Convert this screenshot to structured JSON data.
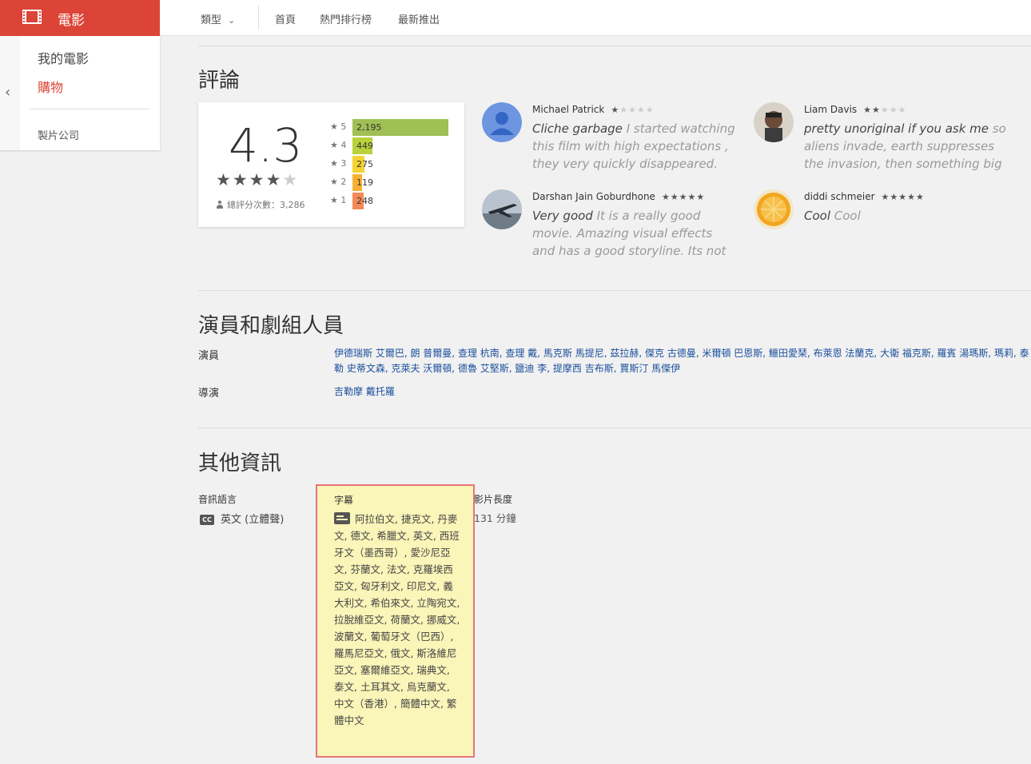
{
  "app": {
    "title": "電影",
    "nav": {
      "genre": "類型",
      "home": "首頁",
      "top_charts": "熱門排行榜",
      "new_releases": "最新推出"
    }
  },
  "sidebar": {
    "items": [
      {
        "label": "我的電影"
      },
      {
        "label": "購物"
      },
      {
        "label": "製片公司"
      }
    ],
    "active": "購物"
  },
  "reviews_section": {
    "title": "評論",
    "average": "4.3",
    "total_label": "總評分次數：3,286",
    "distribution": [
      {
        "stars": "★ 5",
        "count": "2,195",
        "value": 2195,
        "color": "#9fc054"
      },
      {
        "stars": "★ 4",
        "count": "449",
        "value": 449,
        "color": "#b8d23a"
      },
      {
        "stars": "★ 3",
        "count": "275",
        "value": 275,
        "color": "#f4d430"
      },
      {
        "stars": "★ 2",
        "count": "119",
        "value": 119,
        "color": "#f9b133"
      },
      {
        "stars": "★ 1",
        "count": "248",
        "value": 248,
        "color": "#f48a56"
      }
    ],
    "reviews": [
      {
        "name": "Michael Patrick",
        "rating": 1,
        "headline": "Cliche garbage",
        "body": "I started watching this film with high expectations , they very quickly disappeared. Every character is",
        "avatar": "default"
      },
      {
        "name": "Liam Davis",
        "rating": 2,
        "headline": "pretty unoriginal if you ask me",
        "body": "so aliens invade, earth suppresses the invasion, then something big happens",
        "avatar": "photo"
      },
      {
        "name": "Darshan Jain Goburdhone",
        "rating": 5,
        "headline": "Very good",
        "body": "It is a really good movie. Amazing visual effects and has a good storyline. Its not like Transformers",
        "avatar": "jet"
      },
      {
        "name": "diddi schmeier",
        "rating": 5,
        "headline": "Cool",
        "body": "Cool",
        "avatar": "orange"
      }
    ]
  },
  "cast_section": {
    "title": "演員和劇組人員",
    "actors_label": "演員",
    "actors": [
      "伊德瑞斯 艾爾巴",
      "朗 普爾曼",
      "查理 杭南",
      "查理 戴",
      "馬克斯 馬提尼",
      "茲拉赫",
      "傑克 古德曼",
      "米爾頓 巴恩斯",
      "鱷田愛琹",
      "布萊恩 法蘭克",
      "大衛 福克斯",
      "羅賓 湯瑪斯",
      "瑪莉",
      "泰勒 史蒂文森",
      "克萊夫 沃爾頓",
      "德魯 艾堅斯",
      "鹽迪 李",
      "提摩西 吉布斯",
      "賈斯汀 馬傑伊"
    ],
    "director_label": "導演",
    "director": "吉勒摩 戴托羅"
  },
  "info_section": {
    "title": "其他資訊",
    "audio_label": "音訊語言",
    "audio_value": "英文 (立體聲)",
    "cc_icon": "CC",
    "subtitles_label": "字幕",
    "subtitles": "阿拉伯文, 捷克文, 丹麥文, 德文, 希臘文, 英文, 西班牙文（墨西哥）, 愛沙尼亞文, 芬蘭文, 法文, 克羅埃西亞文, 匈牙利文, 印尼文, 義大利文, 希伯來文, 立陶宛文, 拉脫維亞文, 荷蘭文, 挪威文, 波蘭文, 葡萄牙文（巴西）, 羅馬尼亞文, 俄文, 斯洛維尼亞文, 塞爾維亞文, 瑞典文, 泰文, 土耳其文, 烏克蘭文, 中文（香港）, 簡體中文, 繁體中文",
    "runtime_label": "影片長度",
    "runtime_value": "131 分鐘"
  },
  "colors": {
    "brand": "#db4437",
    "link": "#1a4f9c",
    "highlight_fill": "#faf5b8",
    "highlight_border": "#e8747a"
  }
}
